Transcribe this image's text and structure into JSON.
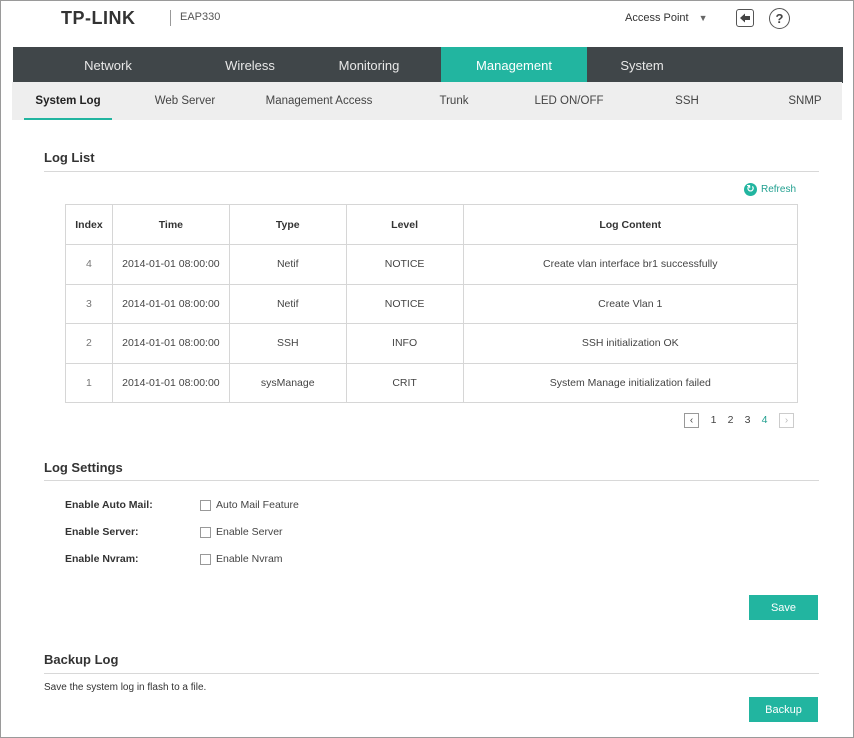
{
  "header": {
    "brand": "TP-LINK",
    "model": "EAP330",
    "mode": "Access Point",
    "help_glyph": "?",
    "logout_glyph": "⇦"
  },
  "nav": {
    "items": [
      {
        "label": "Network"
      },
      {
        "label": "Wireless"
      },
      {
        "label": "Monitoring"
      },
      {
        "label": "Management"
      },
      {
        "label": "System"
      }
    ],
    "active": "Management"
  },
  "subnav": {
    "items": [
      {
        "label": "System Log"
      },
      {
        "label": "Web Server"
      },
      {
        "label": "Management Access"
      },
      {
        "label": "Trunk"
      },
      {
        "label": "LED ON/OFF"
      },
      {
        "label": "SSH"
      },
      {
        "label": "SNMP"
      }
    ],
    "active": "System Log"
  },
  "log_list": {
    "title": "Log List",
    "refresh_label": "Refresh",
    "refresh_glyph": "↻",
    "columns": [
      "Index",
      "Time",
      "Type",
      "Level",
      "Log Content"
    ],
    "rows": [
      {
        "index": "4",
        "time": "2014-01-01 08:00:00",
        "type": "Netif",
        "level": "NOTICE",
        "content": "Create vlan interface br1 successfully"
      },
      {
        "index": "3",
        "time": "2014-01-01 08:00:00",
        "type": "Netif",
        "level": "NOTICE",
        "content": "Create Vlan 1"
      },
      {
        "index": "2",
        "time": "2014-01-01 08:00:00",
        "type": "SSH",
        "level": "INFO",
        "content": "SSH initialization OK"
      },
      {
        "index": "1",
        "time": "2014-01-01 08:00:00",
        "type": "sysManage",
        "level": "CRIT",
        "content": "System Manage initialization failed"
      }
    ],
    "pagination": {
      "prev_glyph": "‹",
      "next_glyph": "›",
      "pages": [
        "1",
        "2",
        "3",
        "4"
      ],
      "current": "4"
    }
  },
  "log_settings": {
    "title": "Log Settings",
    "fields": [
      {
        "label": "Enable Auto Mail:",
        "option": "Auto Mail Feature",
        "checked": false
      },
      {
        "label": "Enable Server:",
        "option": "Enable Server",
        "checked": false
      },
      {
        "label": "Enable Nvram:",
        "option": "Enable Nvram",
        "checked": false
      }
    ],
    "save_label": "Save"
  },
  "backup_log": {
    "title": "Backup Log",
    "description": "Save the system log in flash to a file.",
    "backup_label": "Backup"
  },
  "colors": {
    "accent": "#22b5a0",
    "nav_bg": "#404649",
    "subnav_bg": "#eeeeee"
  }
}
